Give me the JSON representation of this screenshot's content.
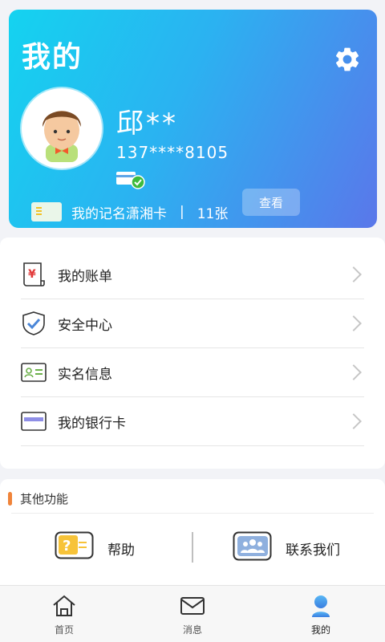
{
  "header": {
    "title": "我的",
    "settings_icon": "gear-icon"
  },
  "profile": {
    "name": "邱**",
    "phone": "137****8105",
    "verified_icon": "verified-card-icon"
  },
  "card_row": {
    "label": "我的记名潇湘卡",
    "separator": "|",
    "count": "11张",
    "view_button": "查看"
  },
  "menu": {
    "items": [
      {
        "label": "我的账单",
        "icon": "bill-icon"
      },
      {
        "label": "安全中心",
        "icon": "shield-icon"
      },
      {
        "label": "实名信息",
        "icon": "id-card-icon"
      },
      {
        "label": "我的银行卡",
        "icon": "bank-card-icon"
      }
    ]
  },
  "other_functions": {
    "title": "其他功能",
    "items": [
      {
        "label": "帮助",
        "icon": "help-icon"
      },
      {
        "label": "联系我们",
        "icon": "contact-us-icon"
      }
    ]
  },
  "tabbar": {
    "items": [
      {
        "label": "首页",
        "icon": "home-icon"
      },
      {
        "label": "消息",
        "icon": "message-icon"
      },
      {
        "label": "我的",
        "icon": "profile-icon"
      }
    ],
    "active": "我的"
  },
  "colors": {
    "hero_gradient_start": "#14d3f0",
    "hero_gradient_end": "#5a77ea",
    "accent_orange": "#f0843a",
    "verified_green": "#3dbb3d"
  }
}
